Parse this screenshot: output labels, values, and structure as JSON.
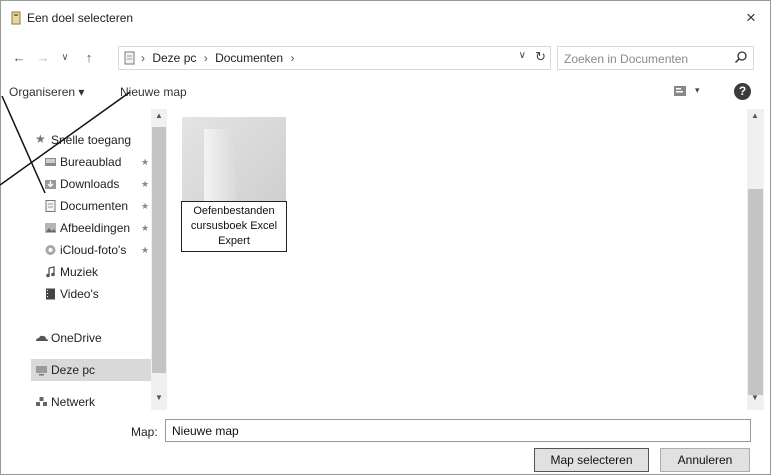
{
  "window": {
    "title": "Een doel selecteren",
    "close_label": "×"
  },
  "nav": {
    "back": "←",
    "forward": "→",
    "history": "∨",
    "up": "↑",
    "breadcrumbs": [
      "Deze pc",
      "Documenten"
    ],
    "separator": "›",
    "dropdown": "∨",
    "refresh": "↻",
    "search_placeholder": "Zoeken in Documenten"
  },
  "toolbar": {
    "organize_label": "Organiseren ▾",
    "new_folder_label": "Nieuwe map",
    "view_dropdown": "▾",
    "help_label": "?"
  },
  "sidebar": {
    "items": [
      {
        "label": "Snelle toegang",
        "icon": "star-icon",
        "pinned": false
      },
      {
        "label": "Bureaublad",
        "icon": "desktop-icon",
        "pinned": true
      },
      {
        "label": "Downloads",
        "icon": "downloads-icon",
        "pinned": true
      },
      {
        "label": "Documenten",
        "icon": "documents-icon",
        "pinned": true
      },
      {
        "label": "Afbeeldingen",
        "icon": "pictures-icon",
        "pinned": true
      },
      {
        "label": "iCloud-foto's",
        "icon": "icloud-photos-icon",
        "pinned": true
      },
      {
        "label": "Muziek",
        "icon": "music-icon",
        "pinned": false
      },
      {
        "label": "Video's",
        "icon": "videos-icon",
        "pinned": false
      },
      {
        "label": "OneDrive",
        "icon": "onedrive-icon",
        "pinned": false
      },
      {
        "label": "Deze pc",
        "icon": "pc-icon",
        "pinned": false
      },
      {
        "label": "Netwerk",
        "icon": "network-icon",
        "pinned": false
      }
    ],
    "pin_glyph": "★"
  },
  "main": {
    "folders": [
      {
        "label": "Oefenbestanden cursusboek Excel Expert"
      }
    ]
  },
  "footer": {
    "folder_label": "Map:",
    "folder_value": "Nieuwe map",
    "select_button": "Map selecteren",
    "cancel_button": "Annuleren"
  }
}
